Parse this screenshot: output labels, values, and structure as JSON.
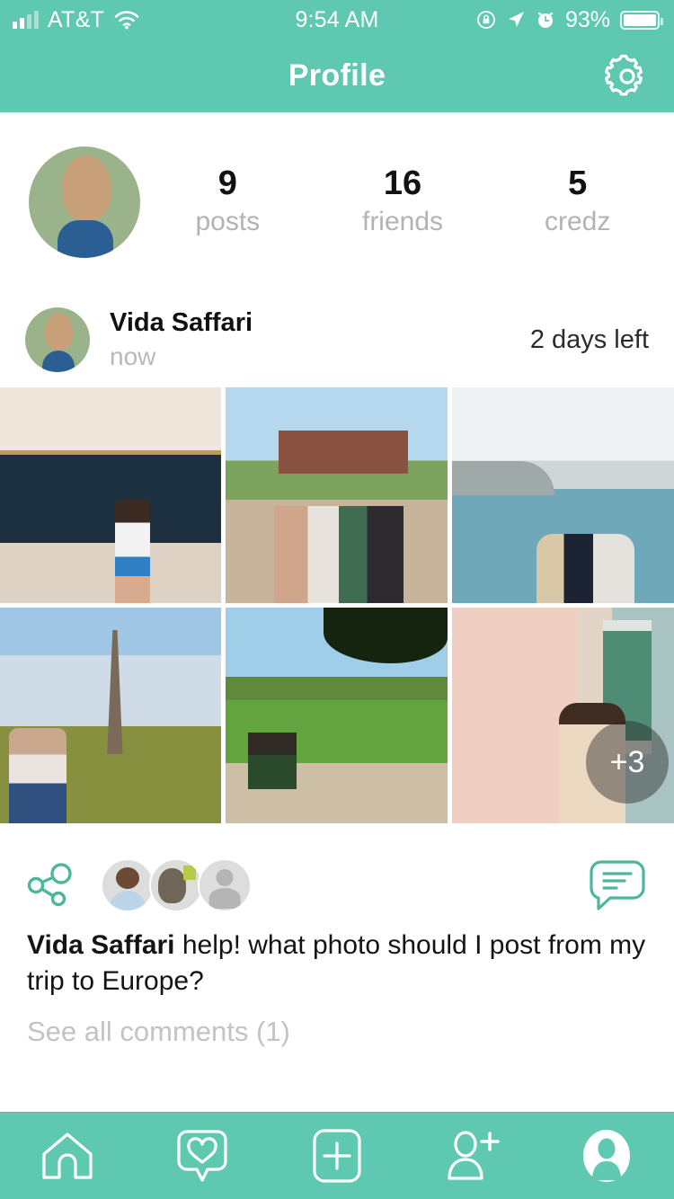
{
  "status_bar": {
    "carrier": "AT&T",
    "time": "9:54 AM",
    "battery_percent": "93%",
    "icons": [
      "signal-bars-icon",
      "wifi-icon",
      "rotation-lock-icon",
      "location-arrow-icon",
      "alarm-clock-icon",
      "battery-icon"
    ]
  },
  "nav": {
    "title": "Profile",
    "settings_icon": "gear-icon"
  },
  "profile": {
    "avatar": "user-avatar",
    "stats": [
      {
        "value": "9",
        "label": "posts"
      },
      {
        "value": "16",
        "label": "friends"
      },
      {
        "value": "5",
        "label": "credz"
      }
    ]
  },
  "post": {
    "author": "Vida Saffari",
    "timestamp": "now",
    "expiry": "2 days left",
    "photos": [
      {
        "alt": "museum-monet-waterlilies",
        "style": "p-museum"
      },
      {
        "alt": "kensington-palace-three-friends",
        "style": "p-palace"
      },
      {
        "alt": "seine-river-bridge-two-friends",
        "style": "p-seine"
      },
      {
        "alt": "eiffel-tower-two-friends",
        "style": "p-eiffel"
      },
      {
        "alt": "tuileries-garden-chairs",
        "style": "p-garden"
      },
      {
        "alt": "la-maison-rose-two-friends",
        "style": "p-maison"
      }
    ],
    "more_count": "+3",
    "share_icon": "share-icon",
    "comment_icon": "comment-bubble-icon",
    "commenters": [
      {
        "alt": "man-with-glasses-avatar",
        "style": "p-man"
      },
      {
        "alt": "elephant-photo-avatar",
        "style": "p-eleph"
      },
      {
        "alt": "default-person-avatar",
        "style": "p-placeholder"
      }
    ],
    "caption_author": "Vida Saffari",
    "caption_text": " help! what photo should I post from my trip to Europe?",
    "see_all_comments": "See all comments (1)"
  },
  "tabbar": {
    "items": [
      {
        "name": "home",
        "icon": "home-icon",
        "active": false
      },
      {
        "name": "activity",
        "icon": "heart-bubble-icon",
        "active": false
      },
      {
        "name": "create",
        "icon": "plus-square-icon",
        "active": false
      },
      {
        "name": "add-friend",
        "icon": "add-person-icon",
        "active": false
      },
      {
        "name": "profile",
        "icon": "person-circle-icon",
        "active": true
      }
    ]
  },
  "colors": {
    "brand_teal": "#5fc8b0",
    "text_primary": "#141414",
    "text_muted": "#b9b9b9"
  }
}
